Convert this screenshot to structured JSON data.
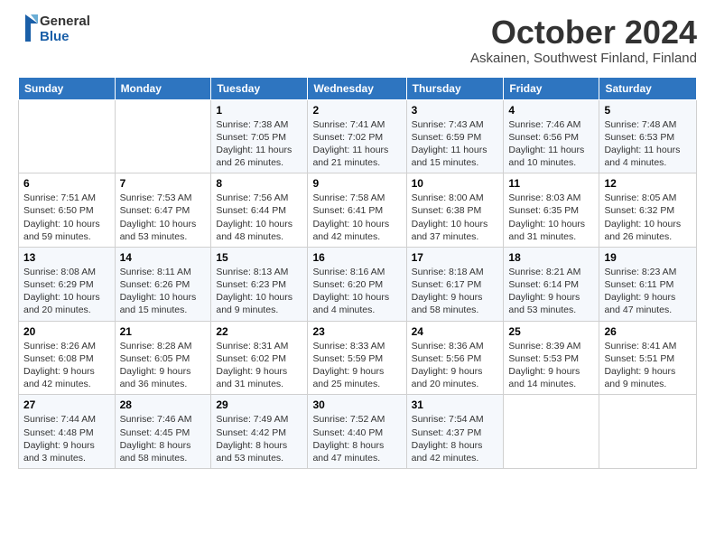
{
  "header": {
    "logo_line1": "General",
    "logo_line2": "Blue",
    "month_title": "October 2024",
    "location": "Askainen, Southwest Finland, Finland"
  },
  "days_of_week": [
    "Sunday",
    "Monday",
    "Tuesday",
    "Wednesday",
    "Thursday",
    "Friday",
    "Saturday"
  ],
  "weeks": [
    [
      {
        "day": "",
        "info": ""
      },
      {
        "day": "",
        "info": ""
      },
      {
        "day": "1",
        "info": "Sunrise: 7:38 AM\nSunset: 7:05 PM\nDaylight: 11 hours and 26 minutes."
      },
      {
        "day": "2",
        "info": "Sunrise: 7:41 AM\nSunset: 7:02 PM\nDaylight: 11 hours and 21 minutes."
      },
      {
        "day": "3",
        "info": "Sunrise: 7:43 AM\nSunset: 6:59 PM\nDaylight: 11 hours and 15 minutes."
      },
      {
        "day": "4",
        "info": "Sunrise: 7:46 AM\nSunset: 6:56 PM\nDaylight: 11 hours and 10 minutes."
      },
      {
        "day": "5",
        "info": "Sunrise: 7:48 AM\nSunset: 6:53 PM\nDaylight: 11 hours and 4 minutes."
      }
    ],
    [
      {
        "day": "6",
        "info": "Sunrise: 7:51 AM\nSunset: 6:50 PM\nDaylight: 10 hours and 59 minutes."
      },
      {
        "day": "7",
        "info": "Sunrise: 7:53 AM\nSunset: 6:47 PM\nDaylight: 10 hours and 53 minutes."
      },
      {
        "day": "8",
        "info": "Sunrise: 7:56 AM\nSunset: 6:44 PM\nDaylight: 10 hours and 48 minutes."
      },
      {
        "day": "9",
        "info": "Sunrise: 7:58 AM\nSunset: 6:41 PM\nDaylight: 10 hours and 42 minutes."
      },
      {
        "day": "10",
        "info": "Sunrise: 8:00 AM\nSunset: 6:38 PM\nDaylight: 10 hours and 37 minutes."
      },
      {
        "day": "11",
        "info": "Sunrise: 8:03 AM\nSunset: 6:35 PM\nDaylight: 10 hours and 31 minutes."
      },
      {
        "day": "12",
        "info": "Sunrise: 8:05 AM\nSunset: 6:32 PM\nDaylight: 10 hours and 26 minutes."
      }
    ],
    [
      {
        "day": "13",
        "info": "Sunrise: 8:08 AM\nSunset: 6:29 PM\nDaylight: 10 hours and 20 minutes."
      },
      {
        "day": "14",
        "info": "Sunrise: 8:11 AM\nSunset: 6:26 PM\nDaylight: 10 hours and 15 minutes."
      },
      {
        "day": "15",
        "info": "Sunrise: 8:13 AM\nSunset: 6:23 PM\nDaylight: 10 hours and 9 minutes."
      },
      {
        "day": "16",
        "info": "Sunrise: 8:16 AM\nSunset: 6:20 PM\nDaylight: 10 hours and 4 minutes."
      },
      {
        "day": "17",
        "info": "Sunrise: 8:18 AM\nSunset: 6:17 PM\nDaylight: 9 hours and 58 minutes."
      },
      {
        "day": "18",
        "info": "Sunrise: 8:21 AM\nSunset: 6:14 PM\nDaylight: 9 hours and 53 minutes."
      },
      {
        "day": "19",
        "info": "Sunrise: 8:23 AM\nSunset: 6:11 PM\nDaylight: 9 hours and 47 minutes."
      }
    ],
    [
      {
        "day": "20",
        "info": "Sunrise: 8:26 AM\nSunset: 6:08 PM\nDaylight: 9 hours and 42 minutes."
      },
      {
        "day": "21",
        "info": "Sunrise: 8:28 AM\nSunset: 6:05 PM\nDaylight: 9 hours and 36 minutes."
      },
      {
        "day": "22",
        "info": "Sunrise: 8:31 AM\nSunset: 6:02 PM\nDaylight: 9 hours and 31 minutes."
      },
      {
        "day": "23",
        "info": "Sunrise: 8:33 AM\nSunset: 5:59 PM\nDaylight: 9 hours and 25 minutes."
      },
      {
        "day": "24",
        "info": "Sunrise: 8:36 AM\nSunset: 5:56 PM\nDaylight: 9 hours and 20 minutes."
      },
      {
        "day": "25",
        "info": "Sunrise: 8:39 AM\nSunset: 5:53 PM\nDaylight: 9 hours and 14 minutes."
      },
      {
        "day": "26",
        "info": "Sunrise: 8:41 AM\nSunset: 5:51 PM\nDaylight: 9 hours and 9 minutes."
      }
    ],
    [
      {
        "day": "27",
        "info": "Sunrise: 7:44 AM\nSunset: 4:48 PM\nDaylight: 9 hours and 3 minutes."
      },
      {
        "day": "28",
        "info": "Sunrise: 7:46 AM\nSunset: 4:45 PM\nDaylight: 8 hours and 58 minutes."
      },
      {
        "day": "29",
        "info": "Sunrise: 7:49 AM\nSunset: 4:42 PM\nDaylight: 8 hours and 53 minutes."
      },
      {
        "day": "30",
        "info": "Sunrise: 7:52 AM\nSunset: 4:40 PM\nDaylight: 8 hours and 47 minutes."
      },
      {
        "day": "31",
        "info": "Sunrise: 7:54 AM\nSunset: 4:37 PM\nDaylight: 8 hours and 42 minutes."
      },
      {
        "day": "",
        "info": ""
      },
      {
        "day": "",
        "info": ""
      }
    ]
  ]
}
